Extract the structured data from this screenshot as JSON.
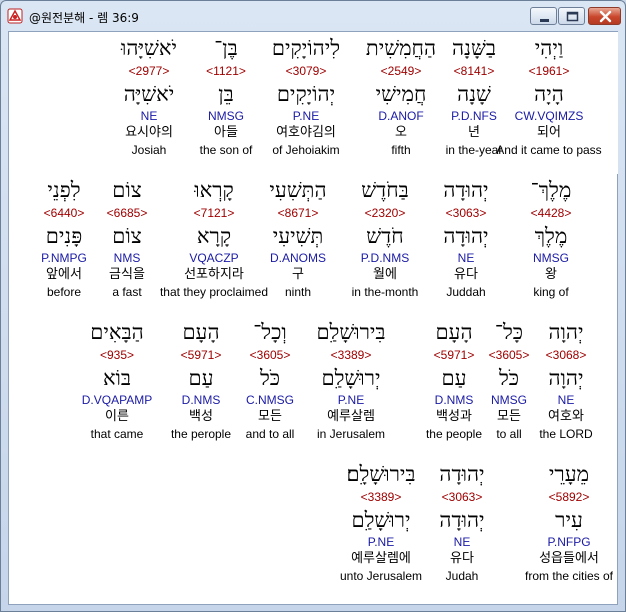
{
  "window": {
    "title": "@원전분해 - 렘 36:9"
  },
  "colors": {
    "strong_number": "#a00000",
    "morph_code": "#1a1aa6"
  },
  "rows": [
    {
      "words": [
        {
          "hebrew": "וַיְהִי",
          "strong": "<1961>",
          "lemma": "הָיָה",
          "code": "CW.VQIMZS",
          "korean": "되어",
          "english": "And it came to pass",
          "highlighted": true
        },
        {
          "hebrew": "בַשָּׁנָה",
          "strong": "<8141>",
          "lemma": "שָׁנָה",
          "code": "P.D.NFS",
          "korean": "년",
          "english": "in the-year"
        },
        {
          "hebrew": "הַחֲמִשִׁית",
          "strong": "<2549>",
          "lemma": "חֲמִישִׁי",
          "code": "D.ANOF",
          "korean": "오",
          "english": "fifth"
        },
        {
          "hebrew": "לִיהוֹיָקִים",
          "strong": "<3079>",
          "lemma": "יְהוֹיָקִים",
          "code": "P.NE",
          "korean": "여호야김의",
          "english": "of Jehoiakim"
        },
        {
          "hebrew": "בֶּן־",
          "strong": "<1121>",
          "lemma": "בֵּן",
          "code": "NMSG",
          "korean": "아들",
          "english": "the son of"
        },
        {
          "hebrew": "יֹאשִׁיָּהוּ",
          "strong": "<2977>",
          "lemma": "יֹאשִׁיָּה",
          "code": "NE",
          "korean": "요시야의",
          "english": "Josiah"
        }
      ]
    },
    {
      "words": [
        {
          "hebrew": "מֶלֶךְ־",
          "strong": "<4428>",
          "lemma": "מֶלֶךְ",
          "code": "NMSG",
          "korean": "왕",
          "english": "king of"
        },
        {
          "hebrew": "יְהוּדָה",
          "strong": "<3063>",
          "lemma": "יְהוּדָה",
          "code": "NE",
          "korean": "유다",
          "english": "Juddah"
        },
        {
          "hebrew": "בַּחֹדֶשׁ",
          "strong": "<2320>",
          "lemma": "חֹדֶשׁ",
          "code": "P.D.NMS",
          "korean": "월에",
          "english": "in the-month"
        },
        {
          "hebrew": "הַתְּשִׁעִי",
          "strong": "<8671>",
          "lemma": "תְּשִׁיעִי",
          "code": "D.ANOMS",
          "korean": "구",
          "english": "ninth"
        },
        {
          "hebrew": "קָרְאוּ",
          "strong": "<7121>",
          "lemma": "קָרָא",
          "code": "VQACZP",
          "korean": "선포하지라",
          "english": "that they proclaimed"
        },
        {
          "hebrew": "צוֹם",
          "strong": "<6685>",
          "lemma": "צוֹם",
          "code": "NMS",
          "korean": "금식을",
          "english": "a fast"
        },
        {
          "hebrew": "לִפְנֵי",
          "strong": "<6440>",
          "lemma": "פָּנִים",
          "code": "P.NMPG",
          "korean": "앞에서",
          "english": "before"
        }
      ]
    },
    {
      "words": [
        {
          "hebrew": "יְהוָה",
          "strong": "<3068>",
          "lemma": "יְהוָה",
          "code": "NE",
          "korean": "여호와",
          "english": "the LORD"
        },
        {
          "hebrew": "כָּל־",
          "strong": "<3605>",
          "lemma": "כֹּל",
          "code": "NMSG",
          "korean": "모든",
          "english": "to all"
        },
        {
          "hebrew": "הָעָם",
          "strong": "<5971>",
          "lemma": "עַם",
          "code": "D.NMS",
          "korean": "백성과",
          "english": "the people"
        },
        {
          "hebrew": "בִּירוּשָׁלִַם",
          "strong": "<3389>",
          "lemma": "יְרוּשָׁלִַם",
          "code": "P.NE",
          "korean": "예루살렘",
          "english": "in Jerusalem"
        },
        {
          "hebrew": "וְכָל־",
          "strong": "<3605>",
          "lemma": "כֹּל",
          "code": "C.NMSG",
          "korean": "모든",
          "english": "and to all"
        },
        {
          "hebrew": "הָעָם",
          "strong": "<5971>",
          "lemma": "עַם",
          "code": "D.NMS",
          "korean": "백성",
          "english": "the perople"
        },
        {
          "hebrew": "הַבָּאִים",
          "strong": "<935>",
          "lemma": "בּוֹא",
          "code": "D.VQAPAMP",
          "korean": "이른",
          "english": "that came"
        }
      ]
    },
    {
      "words": [
        {
          "hebrew": "מֵעָרֵי",
          "strong": "<5892>",
          "lemma": "עִיר",
          "code": "P.NFPG",
          "korean": "성읍들에서",
          "english": "from the cities of"
        },
        {
          "hebrew": "יְהוּדָה",
          "strong": "<3063>",
          "lemma": "יְהוּדָה",
          "code": "NE",
          "korean": "유다",
          "english": "Judah"
        },
        {
          "hebrew": "בִּירוּשָׁלִָם׃",
          "strong": "<3389>",
          "lemma": "יְרוּשָׁלִַם",
          "code": "P.NE",
          "korean": "예루살렘에",
          "english": "unto Jerusalem"
        }
      ]
    }
  ]
}
